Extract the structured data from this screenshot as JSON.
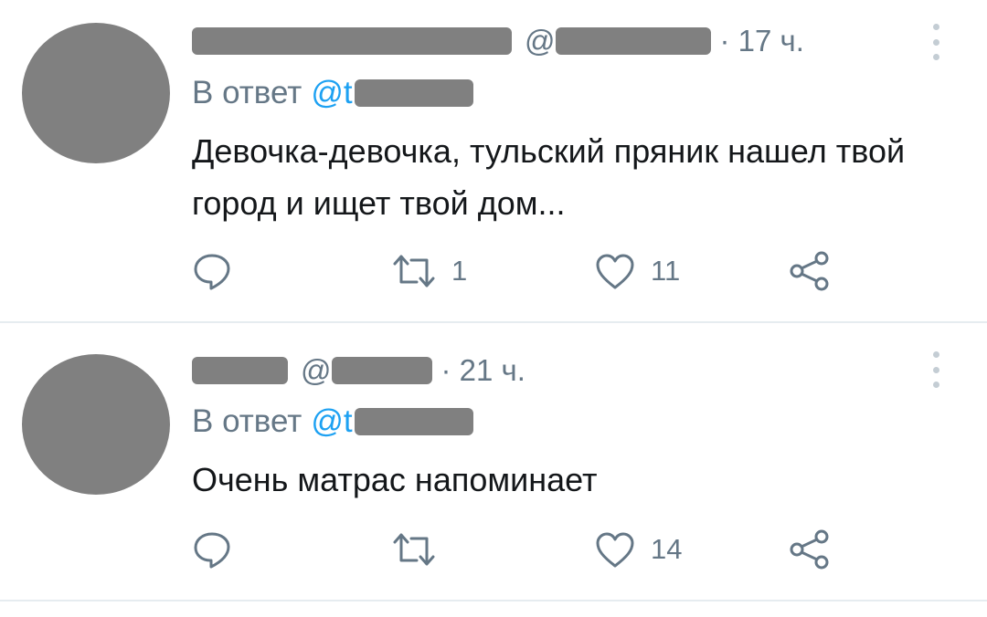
{
  "tweets": [
    {
      "author_redacted": true,
      "handle_prefix": "@",
      "time": "· 17 ч.",
      "reply_label": "В ответ",
      "reply_mention_prefix": "@t",
      "text": "Девочка-девочка, тульский пряник нашел твой город и ищет твой дом...",
      "actions": {
        "reply_count": "",
        "retweet_count": "1",
        "like_count": "11"
      }
    },
    {
      "author_redacted": true,
      "handle_prefix": "@",
      "time": "· 21 ч.",
      "reply_label": "В ответ",
      "reply_mention_prefix": "@t",
      "text": "Очень матрас напоминает",
      "actions": {
        "reply_count": "",
        "retweet_count": "",
        "like_count": "14"
      }
    }
  ],
  "icons": {
    "reply": "reply-icon",
    "retweet": "retweet-icon",
    "like": "heart-icon",
    "share": "share-icon",
    "more": "more-vertical-icon"
  },
  "colors": {
    "text": "#14171a",
    "secondary": "#657786",
    "link": "#1da1f2",
    "redaction": "#808080",
    "divider": "#e6ecf0"
  }
}
